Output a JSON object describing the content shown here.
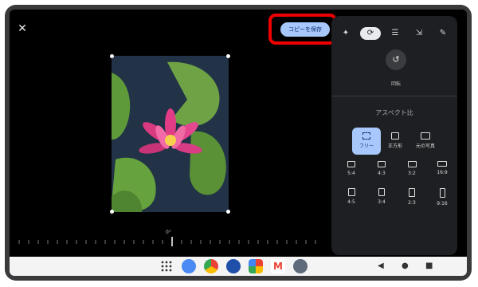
{
  "toolbar": {
    "close_icon": "close-icon",
    "save_label": "コピーを保存"
  },
  "panel": {
    "tabs": [
      "sparkle-icon",
      "crop-rotate-icon",
      "adjust-icon",
      "export-icon",
      "markup-icon"
    ],
    "rotate_label": "回転",
    "aspect_title": "アスペクト比",
    "aspect_options": [
      {
        "label": "フリー",
        "selected": true
      },
      {
        "label": "正方形",
        "selected": false
      },
      {
        "label": "元の写真",
        "selected": false
      }
    ],
    "ratios": [
      "5:4",
      "4:3",
      "3:2",
      "16:9",
      "4:5",
      "3:4",
      "2:3",
      "9:16"
    ]
  },
  "editor": {
    "rotation_degrees": "0°"
  },
  "navbar": {
    "apps": [
      "apps-grid-icon",
      "contacts-icon",
      "chrome-icon",
      "camera-icon",
      "photos-icon",
      "gmail-icon",
      "settings-icon"
    ],
    "back": "◀",
    "home": "●",
    "recents": "■"
  },
  "colors": {
    "accent": "#a8c7fa",
    "highlight": "#ee0000"
  }
}
